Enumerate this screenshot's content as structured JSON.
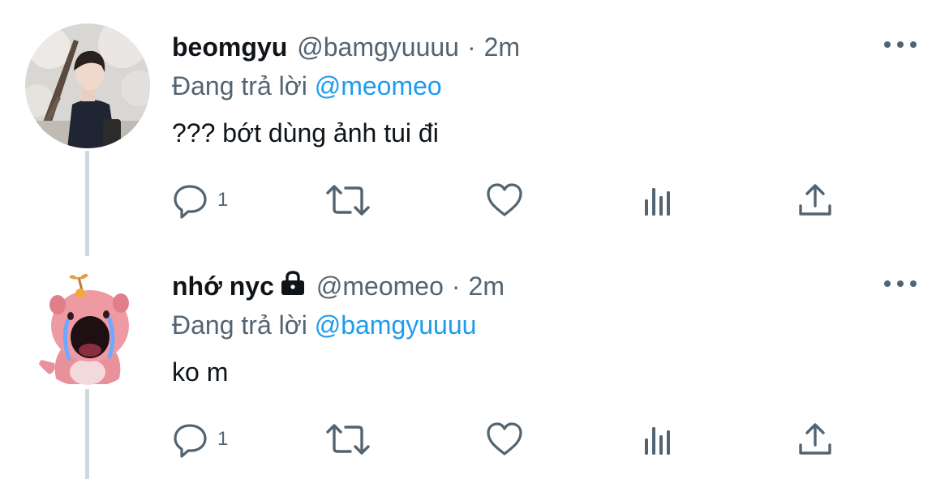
{
  "tweets": [
    {
      "author_name": "beomgyu",
      "handle": "@bamgyuuuu",
      "dot": "·",
      "time": "2m",
      "replying_prefix": "Đang trả lời",
      "replying_to": "@meomeo",
      "text": "??? bớt dùng ảnh tui đi",
      "reply_count": "1",
      "locked": false
    },
    {
      "author_name": "nhớ nyc",
      "handle": "@meomeo",
      "dot": "·",
      "time": "2m",
      "replying_prefix": "Đang trả lời",
      "replying_to": "@bamgyuuuu",
      "text": "ko m",
      "reply_count": "1",
      "locked": true
    }
  ],
  "colors": {
    "text": "#0f1419",
    "secondary": "#536471",
    "link": "#1d9bf0",
    "thread_line": "#cfd9de"
  },
  "icons": {
    "reply": "speech-bubble",
    "retweet": "arrows-loop",
    "like": "heart",
    "views": "bar-chart",
    "share": "upload-arrow",
    "more": "three-dots",
    "protected": "lock"
  }
}
